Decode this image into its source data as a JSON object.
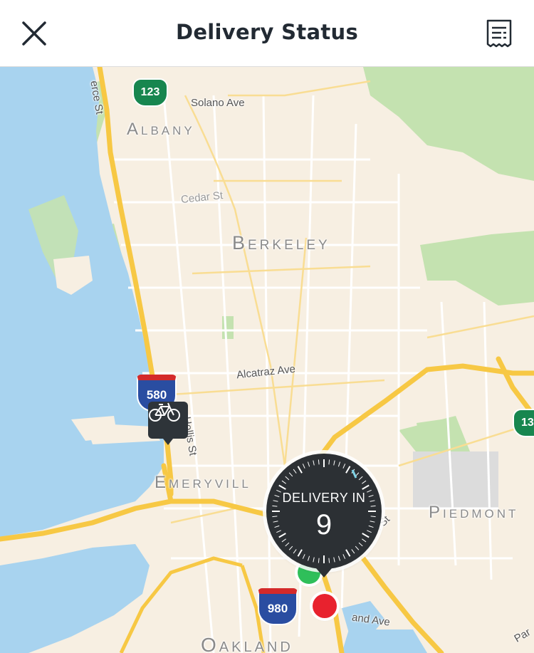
{
  "header": {
    "title": "Delivery Status",
    "close_icon": "close-icon",
    "receipt_icon": "receipt-icon"
  },
  "map": {
    "streets": {
      "solano": "Solano Ave",
      "pierce": "erce St",
      "cedar": "Cedar St",
      "alcatraz": "Alcatraz Ave",
      "hollis": "Hollis St",
      "harrison": "Harrison St",
      "grand": "and Ave",
      "par": "Par"
    },
    "cities": {
      "albany": "Albany",
      "berkeley": "Berkeley",
      "emeryville": "Emeryvill",
      "piedmont": "Piedmont",
      "oakland": "Oakland"
    },
    "highways": {
      "ca123": "123",
      "i580": "580",
      "i980": "980",
      "ca13": "13"
    }
  },
  "delivery": {
    "label": "DELIVERY IN",
    "minutes": "9"
  },
  "markers": {
    "courier_icon": "bicycle-icon",
    "origin_color": "#2fbf5a",
    "destination_color": "#e8222e"
  },
  "colors": {
    "water": "#a8d3ef",
    "park": "#c4e2b0",
    "land": "#f7efe2",
    "highway": "#f7c844"
  }
}
